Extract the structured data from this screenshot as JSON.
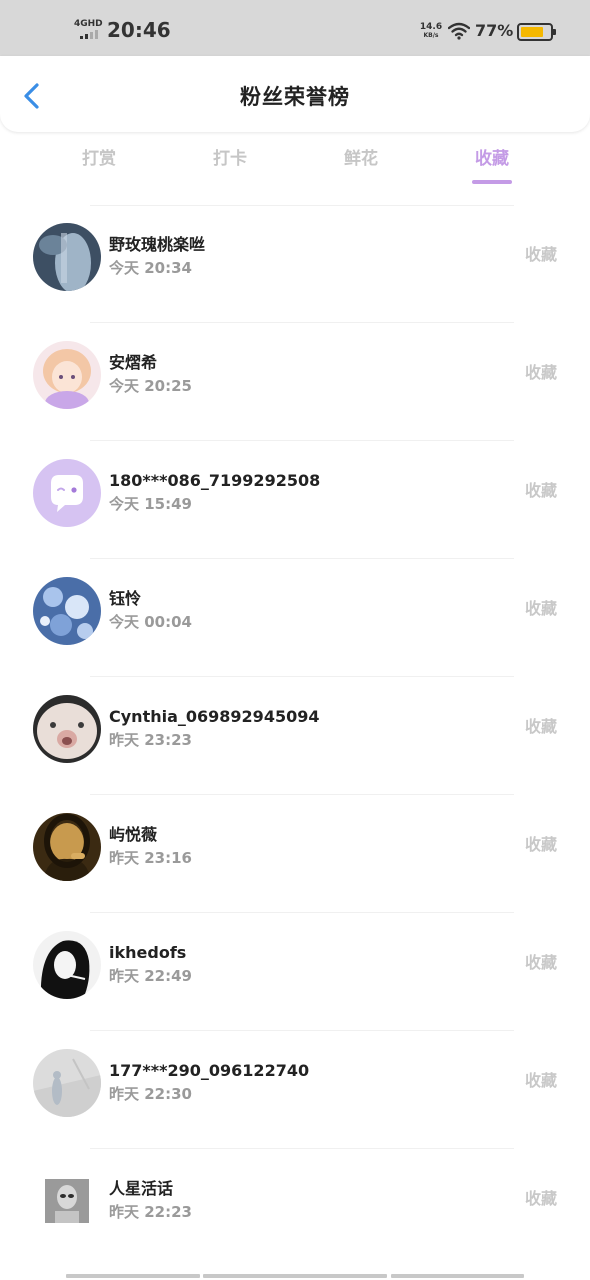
{
  "status_bar": {
    "network": "4GHD",
    "time": "20:46",
    "speed_value": "14.6",
    "speed_unit": "KB/s",
    "battery_pct": "77%",
    "battery_level": 0.77,
    "battery_color": "#f5b800"
  },
  "header": {
    "back_icon": "chevron-left-icon",
    "title": "粉丝荣誉榜"
  },
  "tabs": [
    {
      "label": "打赏",
      "active": false
    },
    {
      "label": "打卡",
      "active": false
    },
    {
      "label": "鲜花",
      "active": false
    },
    {
      "label": "收藏",
      "active": true
    }
  ],
  "accent_color": "#c49be6",
  "list": [
    {
      "name": "野玫瑰桃楽咝",
      "time": "今天 20:34",
      "action": "收藏"
    },
    {
      "name": "安熠希",
      "time": "今天 20:25",
      "action": "收藏"
    },
    {
      "name": "180***086_7199292508",
      "time": "今天 15:49",
      "action": "收藏"
    },
    {
      "name": "钰怜",
      "time": "今天 00:04",
      "action": "收藏"
    },
    {
      "name": "Cynthia_069892945094",
      "time": "昨天 23:23",
      "action": "收藏"
    },
    {
      "name": "屿悦薇",
      "time": "昨天 23:16",
      "action": "收藏"
    },
    {
      "name": "ikhedofs",
      "time": "昨天 22:49",
      "action": "收藏"
    },
    {
      "name": "177***290_096122740",
      "time": "昨天 22:30",
      "action": "收藏"
    },
    {
      "name": "人星活话",
      "time": "昨天 22:23",
      "action": "收藏"
    }
  ]
}
